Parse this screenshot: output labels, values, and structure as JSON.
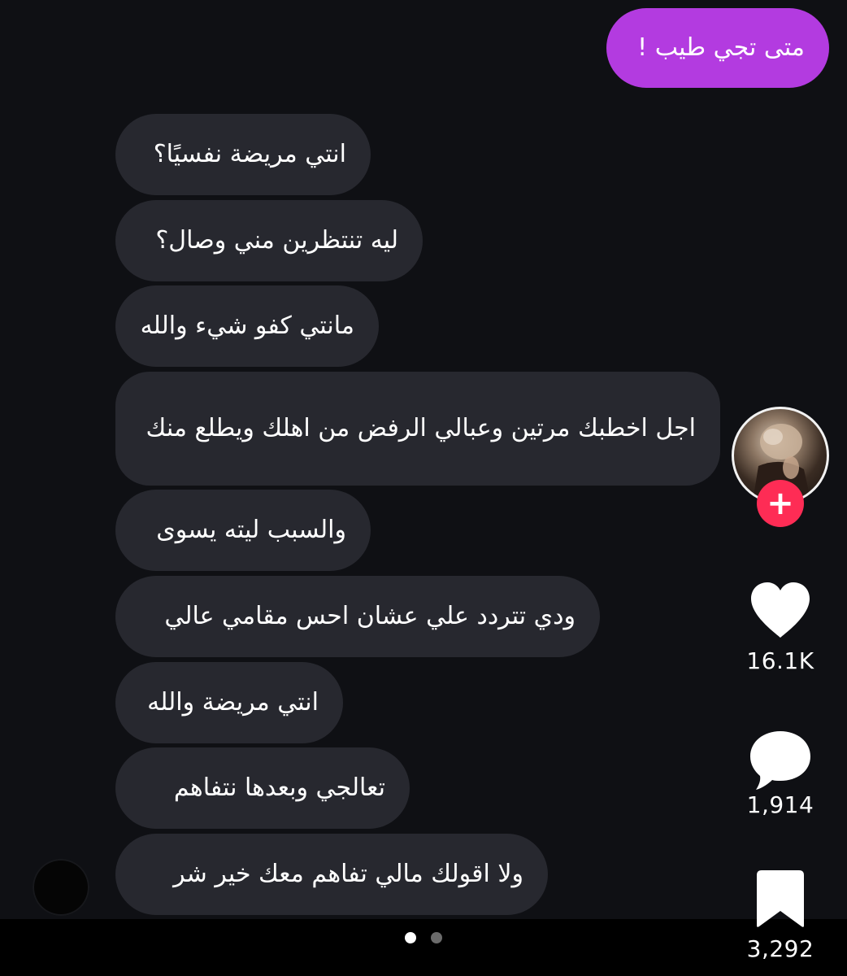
{
  "chat": {
    "sent_message": "متى تجي طيب !",
    "received_messages": [
      "انتي مريضة نفسيًا؟",
      "ليه تنتظرين مني وصال؟",
      "مانتي كفو شيء والله",
      "اجل اخطبك مرتين وعبالي الرفض من اهلك ويطلع منك",
      "والسبب ليته يسوى",
      "ودي تتردد علي عشان احس مقامي عالي",
      "انتي مريضة والله",
      "تعالجي وبعدها نتفاهم",
      "ولا اقولك مالي تفاهم معك خير شر"
    ]
  },
  "actions": {
    "follow_symbol": "+",
    "likes": "16.1K",
    "comments": "1,914",
    "saves": "3,292"
  },
  "pagination": {
    "total_pages": 2,
    "active_page": 1
  },
  "colors": {
    "background": "#0f1014",
    "received_bubble": "#27282f",
    "sent_bubble": "#b33be0",
    "follow_button": "#fe2c55",
    "text": "#ffffff"
  },
  "icons": {
    "like": "heart-icon",
    "comment": "speech-bubble-icon",
    "save": "bookmark-icon",
    "follow": "plus-icon"
  }
}
